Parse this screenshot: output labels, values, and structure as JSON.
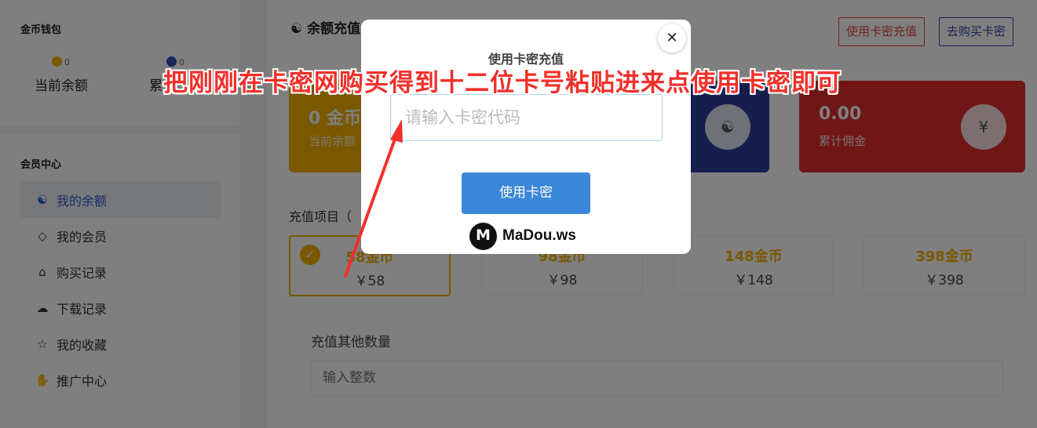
{
  "sidebar": {
    "wallet": {
      "title": "金币钱包",
      "stats": [
        {
          "badge": "0",
          "label": "当前余额",
          "icon": "gold-coin-icon"
        },
        {
          "badge": "0",
          "label": "累",
          "icon": "blue-coin-icon"
        }
      ]
    },
    "member": {
      "title": "会员中心",
      "items": [
        {
          "label": "我的余额",
          "icon": "yin-yang-icon",
          "glyph": "☯",
          "active": true
        },
        {
          "label": "我的会员",
          "icon": "diamond-icon",
          "glyph": "◇",
          "active": false
        },
        {
          "label": "购买记录",
          "icon": "basket-icon",
          "glyph": "⌂",
          "active": false
        },
        {
          "label": "下载记录",
          "icon": "cloud-download-icon",
          "glyph": "☁",
          "active": false
        },
        {
          "label": "我的收藏",
          "icon": "star-icon",
          "glyph": "☆",
          "active": false
        },
        {
          "label": "推广中心",
          "icon": "hand-coin-icon",
          "glyph": "✋",
          "active": false
        }
      ]
    }
  },
  "main": {
    "title": "余额充值",
    "buttons": {
      "use_card": "使用卡密充值",
      "buy_card": "去购买卡密"
    },
    "stats": [
      {
        "value": "0 金币",
        "sub": "当前余额",
        "color": "#f3b000"
      },
      {
        "value": "",
        "sub": "",
        "color": "#2c3c9c",
        "icon": "☯"
      },
      {
        "value": "0.00",
        "sub": "累计佣金",
        "color": "#e02d2d",
        "icon": "¥"
      }
    ],
    "section_label": "充值项目（",
    "packages": [
      {
        "name": "58金币",
        "price": "￥58",
        "selected": true
      },
      {
        "name": "98金币",
        "price": "￥98",
        "selected": false
      },
      {
        "name": "148金币",
        "price": "￥148",
        "selected": false
      },
      {
        "name": "398金币",
        "price": "￥398",
        "selected": false
      }
    ],
    "other_label": "充值其他数量",
    "other_placeholder": "输入整数"
  },
  "modal": {
    "title": "使用卡密充值",
    "close": "✕",
    "input_placeholder": "请输入卡密代码",
    "button": "使用卡密",
    "logo_mark": "M",
    "logo_text": "MaDou.ws"
  },
  "annotation": {
    "text": "把刚刚在卡密网购买得到十二位卡号粘贴进来点使用卡密即可",
    "color": "#f0302a"
  }
}
